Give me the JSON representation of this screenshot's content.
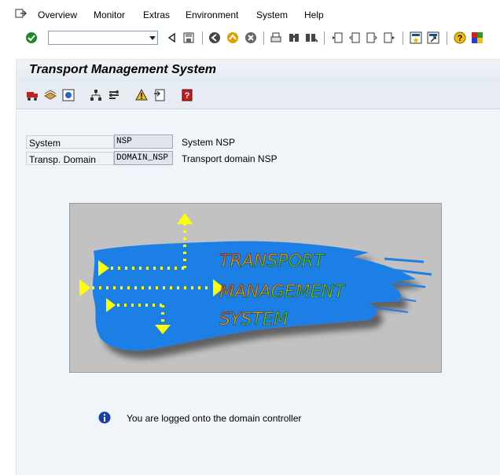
{
  "menu": {
    "items": [
      {
        "label": "Overview"
      },
      {
        "label": "Monitor"
      },
      {
        "label": "Extras"
      },
      {
        "label": "Environment"
      },
      {
        "label": "System"
      },
      {
        "label": "Help"
      }
    ]
  },
  "toolbar": {
    "command_field_value": ""
  },
  "page": {
    "title": "Transport Management System"
  },
  "form": {
    "system_label": "System",
    "system_value": "NSP",
    "system_desc": "System NSP",
    "domain_label": "Transp. Domain",
    "domain_value": "DOMAIN_NSP",
    "domain_desc": "Transport domain NSP"
  },
  "logo": {
    "line1": "TRANSPORT",
    "line2": "MANAGEMENT",
    "line3": "SYSTEM"
  },
  "message": {
    "text": "You are logged onto the domain controller"
  },
  "colors": {
    "brush_blue": "#1f7fe6",
    "arrow_yellow": "#ffff00",
    "logo_bg": "#c2c2c2",
    "content_bg": "#f0f5f9"
  }
}
